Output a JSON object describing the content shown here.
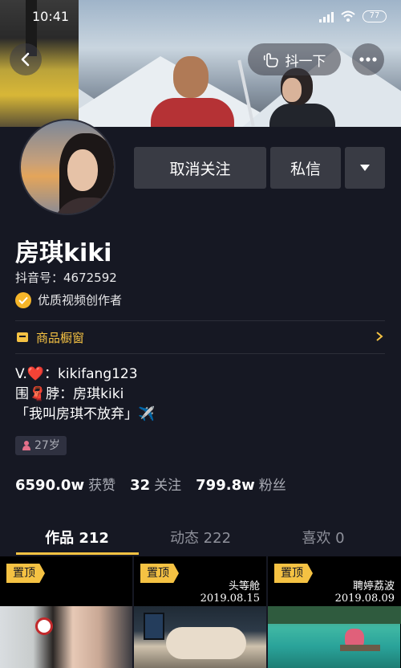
{
  "status_bar": {
    "time": "10:41",
    "battery": "77"
  },
  "nav": {
    "shake_label": "抖一下"
  },
  "profile": {
    "unfollow_label": "取消关注",
    "message_label": "私信",
    "name": "房琪kiki",
    "douyin_id": "抖音号：4672592",
    "verify_label": "优质视频创作者",
    "shop_label": "商品橱窗",
    "bio": [
      "V.❤️：kikifang123",
      "围🧣脖：房琪kiki",
      "「我叫房琪不放弃」✈️"
    ],
    "age": "27岁"
  },
  "stats": [
    {
      "value": "6590.0w",
      "label": "获赞"
    },
    {
      "value": "32",
      "label": "关注"
    },
    {
      "value": "799.8w",
      "label": "粉丝"
    }
  ],
  "tabs": [
    {
      "label": "作品 212",
      "active": true
    },
    {
      "label": "动态 222",
      "active": false
    },
    {
      "label": "喜欢 0",
      "active": false
    }
  ],
  "videos": [
    {
      "pin": "置顶",
      "caption_title": "",
      "caption_date": ""
    },
    {
      "pin": "置顶",
      "caption_title": "头等舱",
      "caption_date": "2019.08.15"
    },
    {
      "pin": "置顶",
      "caption_title": "聘婷荔波",
      "caption_date": "2019.08.09"
    }
  ],
  "colors": {
    "background": "#161823",
    "accent": "#f5c243",
    "button": "#393b44"
  },
  "icons": [
    "back-arrow-icon",
    "shake-hand-icon",
    "more-dots-icon",
    "dropdown-triangle-icon",
    "verified-check-icon",
    "shop-icon",
    "chevron-right-icon",
    "gender-female-icon"
  ]
}
